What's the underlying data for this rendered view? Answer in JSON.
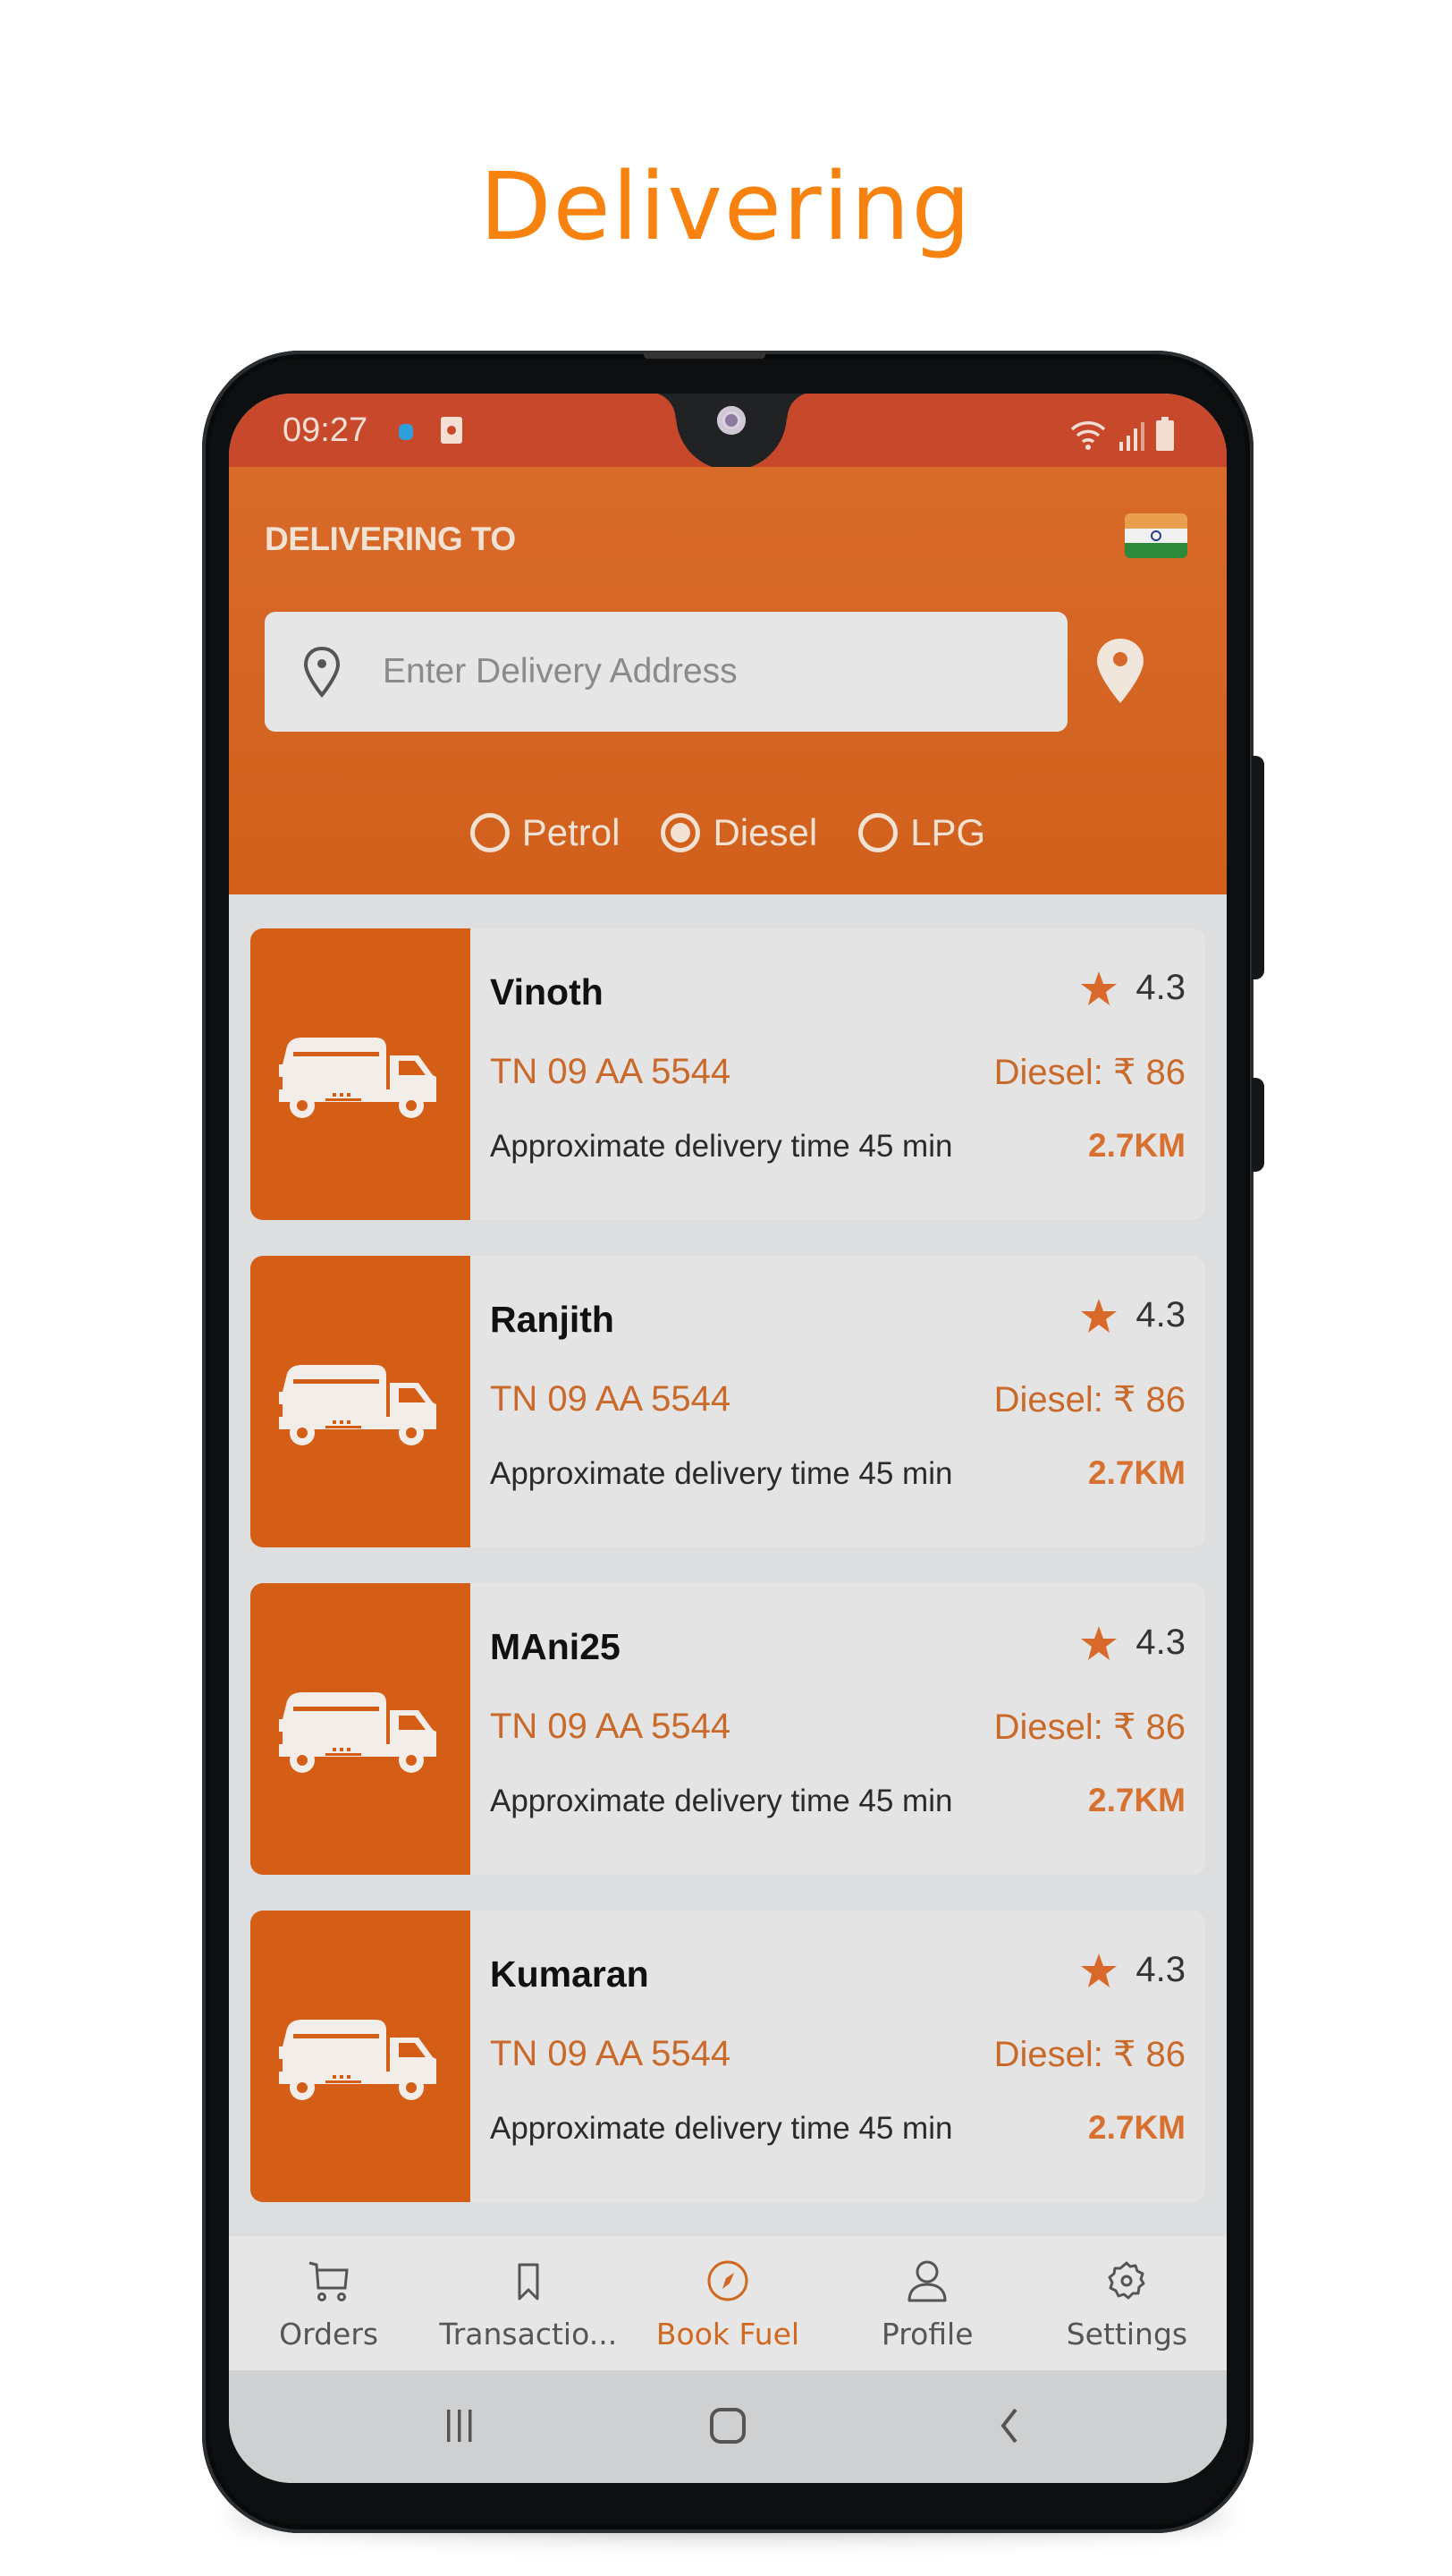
{
  "promo": {
    "title": "Delivering"
  },
  "status_bar": {
    "time": "09:27",
    "icons": [
      "notification-dot-icon",
      "app-notification-icon",
      "wifi-icon",
      "signal-icon",
      "battery-icon"
    ]
  },
  "header": {
    "label": "DELIVERING TO",
    "country_flag": "india-flag-icon",
    "address_input": {
      "value": "",
      "placeholder": "Enter Delivery Address"
    },
    "locate_icon": "location-pin-icon",
    "fuel_types": [
      {
        "label": "Petrol",
        "selected": false
      },
      {
        "label": "Diesel",
        "selected": true
      },
      {
        "label": "LPG",
        "selected": false
      }
    ]
  },
  "colors": {
    "brand": "#d55e16",
    "accent_text": "#c9692a",
    "title": "#f8820f"
  },
  "drivers": [
    {
      "name": "Vinoth",
      "rating": "4.3",
      "plate": "TN 09 AA 5544",
      "price": "Diesel: ₹ 86",
      "eta": "Approximate delivery time 45 min",
      "distance": "2.7KM"
    },
    {
      "name": "Ranjith",
      "rating": "4.3",
      "plate": "TN 09 AA 5544",
      "price": "Diesel: ₹ 86",
      "eta": "Approximate delivery time 45 min",
      "distance": "2.7KM"
    },
    {
      "name": "MAni25",
      "rating": "4.3",
      "plate": "TN 09 AA 5544",
      "price": "Diesel: ₹ 86",
      "eta": "Approximate delivery time 45 min",
      "distance": "2.7KM"
    },
    {
      "name": "Kumaran",
      "rating": "4.3",
      "plate": "TN 09 AA 5544",
      "price": "Diesel: ₹ 86",
      "eta": "Approximate delivery time 45 min",
      "distance": "2.7KM"
    }
  ],
  "bottom_nav": {
    "items": [
      {
        "label": "Orders",
        "icon": "cart-icon",
        "active": false
      },
      {
        "label": "Transactio...",
        "icon": "bookmark-icon",
        "active": false
      },
      {
        "label": "Book Fuel",
        "icon": "compass-icon",
        "active": true
      },
      {
        "label": "Profile",
        "icon": "person-icon",
        "active": false
      },
      {
        "label": "Settings",
        "icon": "gear-icon",
        "active": false
      }
    ]
  },
  "system_nav": {
    "buttons": [
      "recent-apps-icon",
      "home-icon",
      "back-icon"
    ]
  }
}
